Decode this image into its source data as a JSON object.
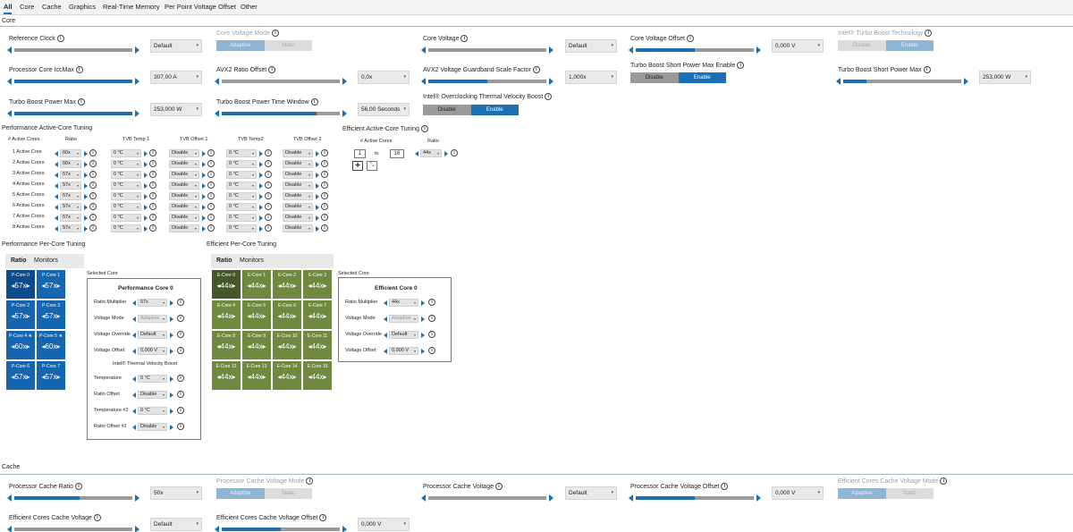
{
  "tabs": [
    "All",
    "Core",
    "Cache",
    "Graphics",
    "Real-Time Memory",
    "Per Point Voltage Offset",
    "Other"
  ],
  "sections": {
    "core": "Core",
    "cache": "Cache"
  },
  "core_controls": {
    "reference_clock": {
      "label": "Reference Clock",
      "value": "Default",
      "level": 0.0
    },
    "core_voltage_mode": {
      "label": "Core Voltage Mode",
      "opt_a": "Adaptive",
      "opt_b": "Static"
    },
    "core_voltage": {
      "label": "Core Voltage",
      "value": "Default",
      "level": 0.0
    },
    "core_voltage_offset": {
      "label": "Core Voltage Offset",
      "value": "0,000 V",
      "level": 0.5
    },
    "turbo_boost_tech": {
      "label": "Intel® Turbo Boost Technology",
      "opt_a": "Disable",
      "opt_b": "Enable"
    },
    "icc_max": {
      "label": "Processor Core IccMax",
      "value": "307,00 A",
      "level": 1.0
    },
    "avx2_ratio_offset": {
      "label": "AVX2 Ratio Offset",
      "value": "0,0x",
      "level": 0.0
    },
    "avx2_guardband": {
      "label": "AVX2 Voltage Guardband Scale Factor",
      "value": "1,000x",
      "level": 0.5
    },
    "turbo_short_enable": {
      "label": "Turbo Boost Short Power Max Enable",
      "opt_a": "Disable",
      "opt_b": "Enable"
    },
    "turbo_short_max": {
      "label": "Turbo Boost Short Power Max",
      "value": "253,000 W",
      "level": 0.2
    },
    "turbo_power_max": {
      "label": "Turbo Boost Power Max",
      "value": "253,000 W",
      "level": 1.0
    },
    "turbo_time_window": {
      "label": "Turbo Boost Power Time Window",
      "value": "56,00 Seconds",
      "level": 0.8
    },
    "tvb": {
      "label": "Intel® Overclocking Thermal Velocity Boost",
      "opt_a": "Disable",
      "opt_b": "Enable"
    }
  },
  "perf_active": {
    "title": "Performance Active-Core Tuning",
    "headers": [
      "# Active Cores",
      "Ratio",
      "TVB Temp 1",
      "TVB Offset 1",
      "TVB Temp2",
      "TVB Offset 2"
    ],
    "rows": [
      {
        "label": "1 Active Core",
        "ratio": "60x",
        "t1": "0 °C",
        "o1": "Disable",
        "t2": "0 °C",
        "o2": "Disable"
      },
      {
        "label": "2 Active Cores",
        "ratio": "60x",
        "t1": "0 °C",
        "o1": "Disable",
        "t2": "0 °C",
        "o2": "Disable"
      },
      {
        "label": "3 Active Cores",
        "ratio": "57x",
        "t1": "0 °C",
        "o1": "Disable",
        "t2": "0 °C",
        "o2": "Disable"
      },
      {
        "label": "4 Active Cores",
        "ratio": "57x",
        "t1": "0 °C",
        "o1": "Disable",
        "t2": "0 °C",
        "o2": "Disable"
      },
      {
        "label": "5 Active Cores",
        "ratio": "57x",
        "t1": "0 °C",
        "o1": "Disable",
        "t2": "0 °C",
        "o2": "Disable"
      },
      {
        "label": "6 Active Cores",
        "ratio": "57x",
        "t1": "0 °C",
        "o1": "Disable",
        "t2": "0 °C",
        "o2": "Disable"
      },
      {
        "label": "7 Active Cores",
        "ratio": "57x",
        "t1": "0 °C",
        "o1": "Disable",
        "t2": "0 °C",
        "o2": "Disable"
      },
      {
        "label": "8 Active Cores",
        "ratio": "57x",
        "t1": "0 °C",
        "o1": "Disable",
        "t2": "0 °C",
        "o2": "Disable"
      }
    ]
  },
  "eff_active": {
    "title": "Efficient Active-Core Tuning",
    "headers": [
      "# Active Cores",
      "Ratio"
    ],
    "from": "1",
    "to_label": "to",
    "to": "16",
    "ratio": "44x"
  },
  "perf_per_core": {
    "title": "Performance Per-Core Tuning",
    "tab_ratio": "Ratio",
    "tab_monitors": "Monitors",
    "cores": [
      {
        "name": "P-Core 0",
        "ratio": "57x"
      },
      {
        "name": "P-Core 1",
        "ratio": "57x"
      },
      {
        "name": "P-Core 2",
        "ratio": "57x"
      },
      {
        "name": "P-Core 3",
        "ratio": "57x"
      },
      {
        "name": "P-Core 4 ★",
        "ratio": "60x"
      },
      {
        "name": "P-Core 5 ★",
        "ratio": "60x"
      },
      {
        "name": "P-Core 6",
        "ratio": "57x"
      },
      {
        "name": "P-Core 7",
        "ratio": "57x"
      }
    ],
    "selected_label": "Selected Core",
    "selected_title": "Performance Core 0",
    "fields": [
      {
        "label": "Ratio Multiplier",
        "value": "57x"
      },
      {
        "label": "Voltage Mode",
        "value": "Adaptive"
      },
      {
        "label": "Voltage Override",
        "value": "Default"
      },
      {
        "label": "Voltage Offset",
        "value": "0,000 V"
      }
    ],
    "tvb_heading": "Intel® Thermal Velocity Boost",
    "tvb_fields": [
      {
        "label": "Temperature",
        "value": "0 °C"
      },
      {
        "label": "Ratio Offset",
        "value": "Disable"
      },
      {
        "label": "Temperature #2",
        "value": "0 °C"
      },
      {
        "label": "Ratio Offset #2",
        "value": "Disable"
      }
    ]
  },
  "eff_per_core": {
    "title": "Efficient Per-Core Tuning",
    "tab_ratio": "Ratio",
    "tab_monitors": "Monitors",
    "cores": [
      {
        "name": "E-Core 0",
        "ratio": "44x"
      },
      {
        "name": "E-Core 1",
        "ratio": "44x"
      },
      {
        "name": "E-Core 2",
        "ratio": "44x"
      },
      {
        "name": "E-Core 3",
        "ratio": "44x"
      },
      {
        "name": "E-Core 4",
        "ratio": "44x"
      },
      {
        "name": "E-Core 5",
        "ratio": "44x"
      },
      {
        "name": "E-Core 6",
        "ratio": "44x"
      },
      {
        "name": "E-Core 7",
        "ratio": "44x"
      },
      {
        "name": "E-Core 8",
        "ratio": "44x"
      },
      {
        "name": "E-Core 9",
        "ratio": "44x"
      },
      {
        "name": "E-Core 10",
        "ratio": "44x"
      },
      {
        "name": "E-Core 11",
        "ratio": "44x"
      },
      {
        "name": "E-Core 12",
        "ratio": "44x"
      },
      {
        "name": "E-Core 13",
        "ratio": "44x"
      },
      {
        "name": "E-Core 14",
        "ratio": "44x"
      },
      {
        "name": "E-Core 15",
        "ratio": "44x"
      }
    ],
    "selected_label": "Selected Core",
    "selected_title": "Efficient Core 0",
    "fields": [
      {
        "label": "Ratio Multiplier",
        "value": "44x"
      },
      {
        "label": "Voltage Mode",
        "value": "Adaptive"
      },
      {
        "label": "Voltage Override",
        "value": "Default"
      },
      {
        "label": "Voltage Offset",
        "value": "0,000 V"
      }
    ]
  },
  "cache_controls": {
    "cache_ratio": {
      "label": "Processor Cache Ratio",
      "value": "50x",
      "level": 0.55
    },
    "cache_voltage_mode": {
      "label": "Processor Cache Voltage Mode",
      "opt_a": "Adaptive",
      "opt_b": "Static"
    },
    "cache_voltage": {
      "label": "Processor Cache Voltage",
      "value": "Default",
      "level": 0.0
    },
    "cache_voltage_offset": {
      "label": "Processor Cache Voltage Offset",
      "value": "0,000 V",
      "level": 0.5
    },
    "eff_cache_mode": {
      "label": "Efficient Cores Cache Voltage Mode",
      "opt_a": "Adaptive",
      "opt_b": "Static"
    },
    "eff_cache_voltage": {
      "label": "Efficient Cores Cache Voltage",
      "value": "Default",
      "level": 0.0
    },
    "eff_cache_offset": {
      "label": "Efficient Cores Cache Voltage Offset",
      "value": "0,000 V",
      "level": 0.5
    }
  }
}
